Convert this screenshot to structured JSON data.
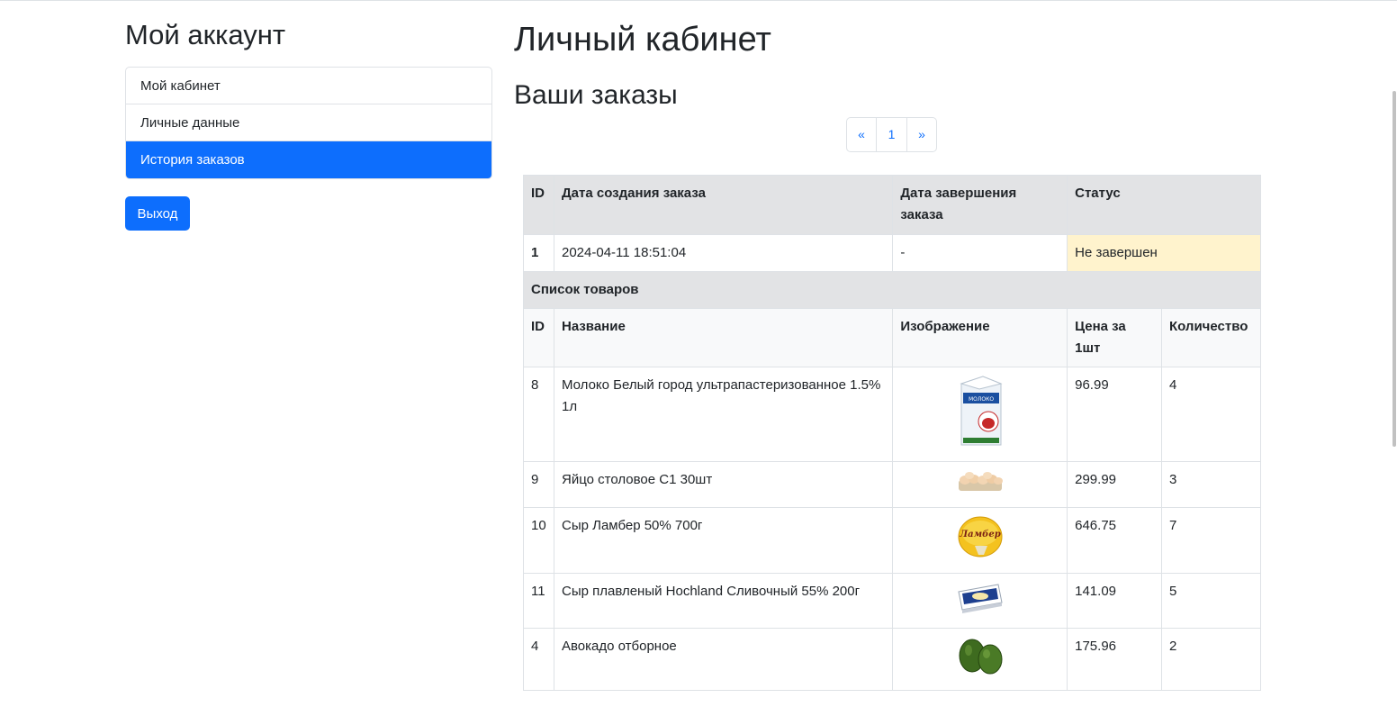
{
  "sidebar": {
    "title": "Мой аккаунт",
    "items": [
      {
        "label": "Мой кабинет",
        "active": false
      },
      {
        "label": "Личные данные",
        "active": false
      },
      {
        "label": "История заказов",
        "active": true
      }
    ],
    "logout_label": "Выход"
  },
  "main": {
    "title": "Личный кабинет",
    "orders_title": "Ваши заказы",
    "pagination": {
      "prev": "«",
      "current": "1",
      "next": "»"
    },
    "order_table": {
      "headers": {
        "id": "ID",
        "created": "Дата создания заказа",
        "completed": "Дата завершения заказа",
        "status": "Статус"
      },
      "order": {
        "id": "1",
        "created": "2024-04-11 18:51:04",
        "completed": "-",
        "status": "Не завершен"
      },
      "items_title": "Список товаров",
      "item_headers": {
        "id": "ID",
        "name": "Название",
        "image": "Изображение",
        "price": "Цена за 1шт",
        "qty": "Количество"
      },
      "items": [
        {
          "id": "8",
          "name": "Молоко Белый город ультрапастеризованное 1.5% 1л",
          "image": "milk-carton",
          "price": "96.99",
          "qty": "4"
        },
        {
          "id": "9",
          "name": "Яйцо столовое С1 30шт",
          "image": "egg-tray",
          "price": "299.99",
          "qty": "3"
        },
        {
          "id": "10",
          "name": "Сыр Ламбер 50% 700г",
          "image": "lamber-cheese",
          "price": "646.75",
          "qty": "7"
        },
        {
          "id": "11",
          "name": "Сыр плавленый Hochland Сливочный 55% 200г",
          "image": "hochland-cheese",
          "price": "141.09",
          "qty": "5"
        },
        {
          "id": "4",
          "name": "Авокадо отборное",
          "image": "avocado",
          "price": "175.96",
          "qty": "2"
        }
      ]
    }
  },
  "colors": {
    "primary": "#0d6efd",
    "warning_bg": "#fff3cd",
    "header_bg": "#e2e3e5"
  },
  "image_text": {
    "milk": "МОЛОКО",
    "lamber": "Ламбер"
  }
}
